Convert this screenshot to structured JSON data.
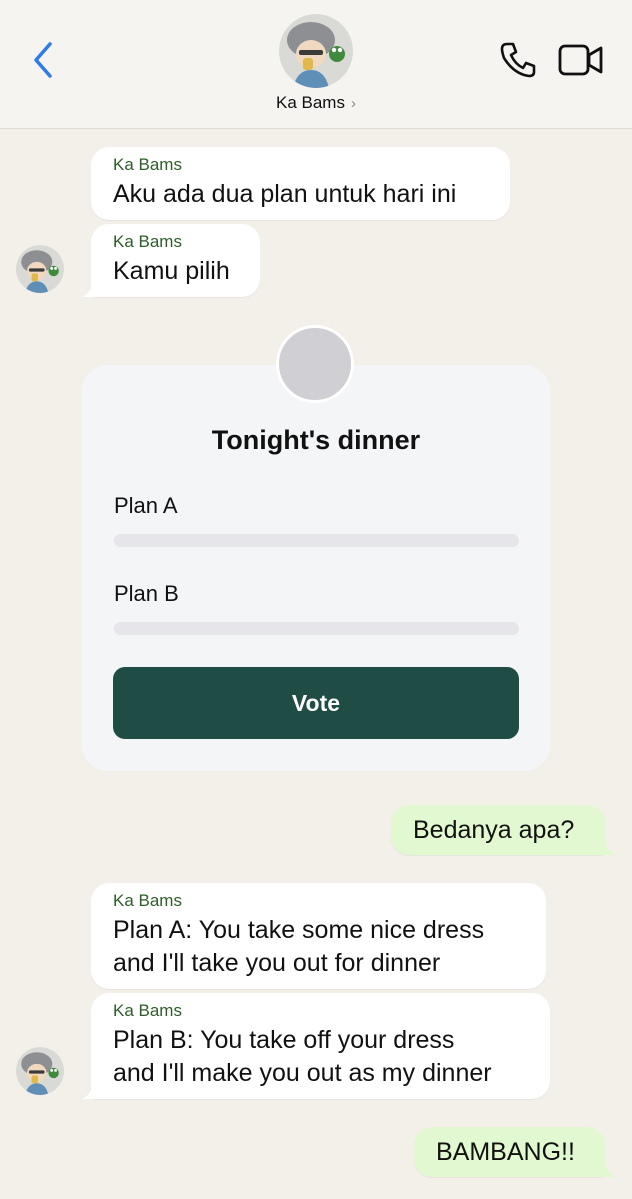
{
  "header": {
    "contact_name": "Ka Bams",
    "chevron": "›"
  },
  "messages": [
    {
      "sender": "Ka Bams",
      "lines": [
        "Aku ada dua plan untuk hari ini"
      ]
    },
    {
      "sender": "Ka Bams",
      "lines": [
        "Kamu pilih"
      ]
    },
    {
      "outgoing": true,
      "lines": [
        "Bedanya apa?"
      ]
    },
    {
      "sender": "Ka Bams",
      "lines": [
        "Plan A: You take some nice dress",
        "and I'll take you out for dinner"
      ]
    },
    {
      "sender": "Ka Bams",
      "lines": [
        "Plan B: You take off your dress",
        "and I'll make you out as my dinner"
      ]
    },
    {
      "outgoing": true,
      "lines": [
        "BAMBANG!!"
      ]
    }
  ],
  "poll": {
    "title": "Tonight's dinner",
    "options": [
      {
        "label": "Plan A",
        "votes_fraction": 0
      },
      {
        "label": "Plan B",
        "votes_fraction": 0
      }
    ],
    "vote_label": "Vote"
  },
  "colors": {
    "accent_blue": "#2f7be5",
    "sender_green": "#2e5d2a",
    "outgoing_bubble": "#e1f8d1",
    "vote_button": "#1f4c44"
  },
  "icons": [
    "back-chevron-icon",
    "phone-icon",
    "video-camera-icon",
    "avatar-image"
  ]
}
